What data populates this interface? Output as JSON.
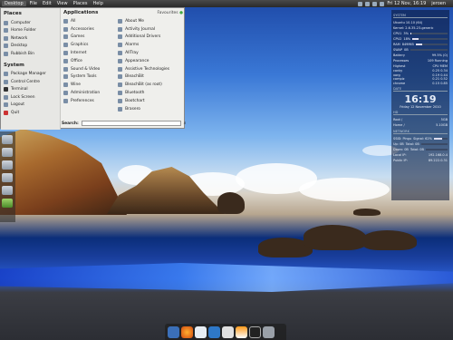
{
  "top_panel": {
    "desktop_label": "Desktop",
    "menus": [
      "File",
      "Edit",
      "View",
      "Places",
      "Help"
    ],
    "clock": "Fri 12 Nov, 16:19",
    "user": "jeroen"
  },
  "menu": {
    "places_header": "Places",
    "places": [
      "Computer",
      "Home Folder",
      "Network",
      "Desktop",
      "Rubbish Bin"
    ],
    "system_header": "System",
    "system": [
      "Package Manager",
      "Control Centre",
      "Terminal",
      "Lock Screen",
      "Logout",
      "Quit"
    ],
    "apps_header": "Applications",
    "favourites_label": "Favourites",
    "categories": [
      "All",
      "Accessories",
      "Games",
      "Graphics",
      "Internet",
      "Office",
      "Sound & Video",
      "System Tools",
      "Wine",
      "Administration",
      "Preferences"
    ],
    "apps": [
      "About Me",
      "Activity Journal",
      "Additional Drivers",
      "Alarms",
      "AllTray",
      "Appearance",
      "Assistive Technologies",
      "BleachBit",
      "BleachBit (as root)",
      "Bluetooth",
      "Bootchart",
      "Brasero"
    ],
    "search_label": "Search:",
    "search_value": ""
  },
  "conky": {
    "system_header": "SYSTEM",
    "system_lines": [
      "Ubuntu 10.10 (64)",
      "Kernel: 2.6.35-23-generic"
    ],
    "cpu_rows": [
      {
        "label": "CPU1",
        "value": "3%",
        "fill": 0.03
      },
      {
        "label": "CPU2",
        "value": "18%",
        "fill": 0.18
      },
      {
        "label": "RAM",
        "value": "849MiB",
        "fill": 0.21
      },
      {
        "label": "SWAP",
        "value": "0B",
        "fill": 0.0
      }
    ],
    "battery": "Battery",
    "battery_value": "99.5% (0)",
    "processes_label": "Processes",
    "processes_value": "109 Running",
    "highest_label": "Highest",
    "highest_cols": [
      "CPU",
      "MEM"
    ],
    "highest_rows": [
      [
        "conky",
        "0.25",
        "0.34"
      ],
      [
        "xorg",
        "0.19",
        "0.44"
      ],
      [
        "compiz",
        "0.21",
        "0.52"
      ],
      [
        "chrome",
        "0.15",
        "0.85"
      ]
    ],
    "date_header": "DATE",
    "time": "16:19",
    "date": "Friday 12 November 2010",
    "hd_header": "HD",
    "hd_rows": [
      {
        "label": "Root /",
        "value": "5GB"
      },
      {
        "label": "Home /",
        "value": "5.10GB"
      }
    ],
    "network_header": "NETWORK",
    "net_rows": [
      {
        "label": "SSID: Pingu",
        "value": "Signal: 62%",
        "fill": 0.62
      },
      {
        "label": "Up: 0B",
        "value": "Total: 0B",
        "fill": 0.0
      },
      {
        "label": "Down: 0B",
        "value": "Total: 0B",
        "fill": 0.0
      }
    ],
    "local_ip": "Local IP:",
    "local_ip_value": "192.168.0.4",
    "public_ip": "Public IP:",
    "public_ip_value": "89.222.0.31"
  },
  "dock_icons": [
    "anchor-icon",
    "firefox-icon",
    "chat-icon",
    "pidgin-icon",
    "disk-icon",
    "vlc-icon",
    "terminal-icon",
    "trash-icon"
  ],
  "colors": {
    "accent": "#3a78d6",
    "panel": "#3a3a3a"
  }
}
